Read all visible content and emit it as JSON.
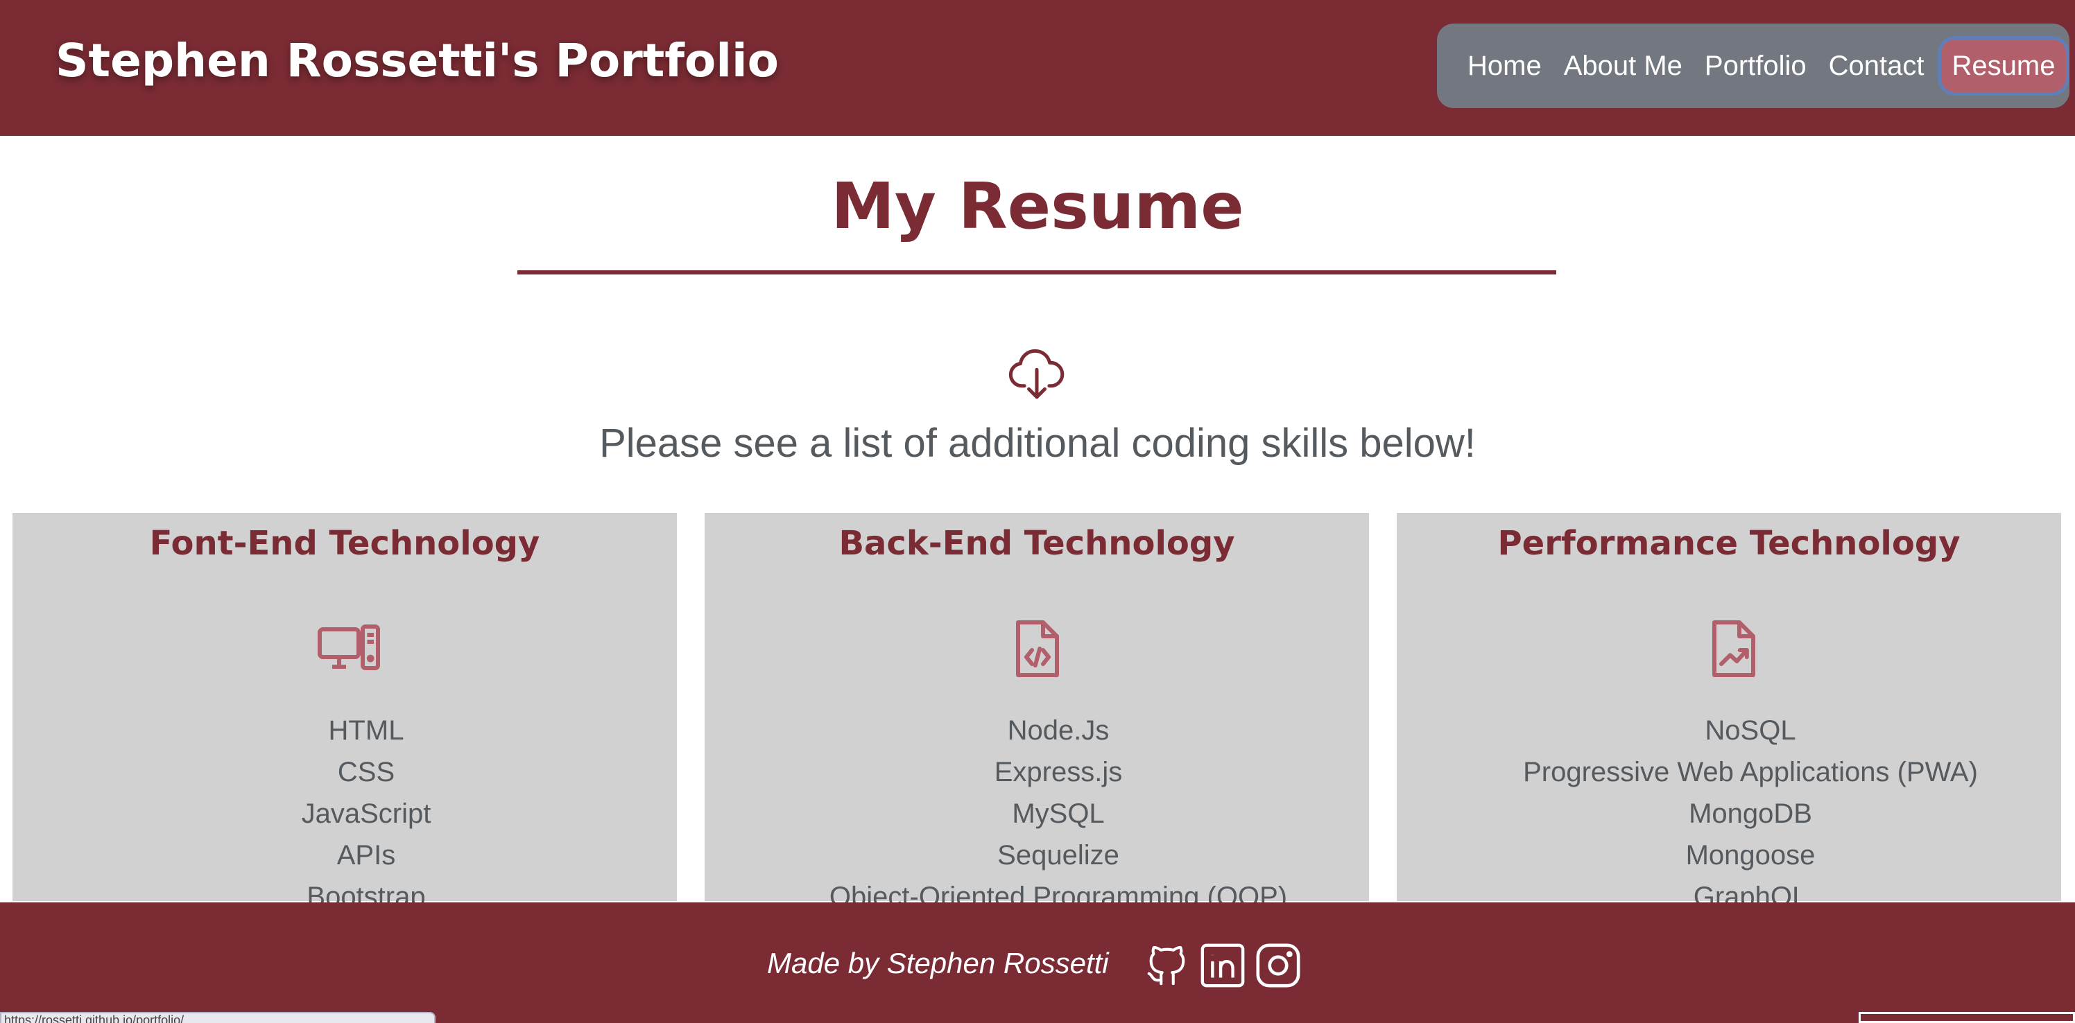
{
  "header": {
    "title": "Stephen Rossetti's Portfolio",
    "nav": [
      {
        "label": "Home"
      },
      {
        "label": "About Me"
      },
      {
        "label": "Portfolio"
      },
      {
        "label": "Contact"
      },
      {
        "label": "Resume",
        "active": true
      }
    ]
  },
  "main": {
    "heading": "My Resume",
    "download_icon": "cloud-download-icon",
    "intro": "Please see a list of additional coding skills below!",
    "cards": [
      {
        "title": "Font-End Technology",
        "icon": "desktop-computer-icon",
        "skills": [
          "HTML",
          "CSS",
          "JavaScript",
          "APIs",
          "Bootstrap"
        ]
      },
      {
        "title": "Back-End Technology",
        "icon": "code-file-icon",
        "skills": [
          "Node.Js",
          "Express.js",
          "MySQL",
          "Sequelize",
          "Object-Oriented Programming (OOP)"
        ]
      },
      {
        "title": "Performance Technology",
        "icon": "chart-file-icon",
        "skills": [
          "NoSQL",
          "Progressive Web Applications (PWA)",
          "MongoDB",
          "Mongoose",
          "GraphQL"
        ]
      }
    ]
  },
  "footer": {
    "credit": "Made by Stephen Rossetti",
    "social_icons": [
      "github-icon",
      "linkedin-icon",
      "instagram-icon"
    ]
  },
  "status_bar": {
    "url": "https://rossetti.github.io/portfolio/"
  },
  "colors": {
    "brand": "#7a2b33",
    "nav_bg": "#737880",
    "nav_active": "#b05f6b",
    "card_bg": "#d1d1d1",
    "text": "#555a5f"
  }
}
